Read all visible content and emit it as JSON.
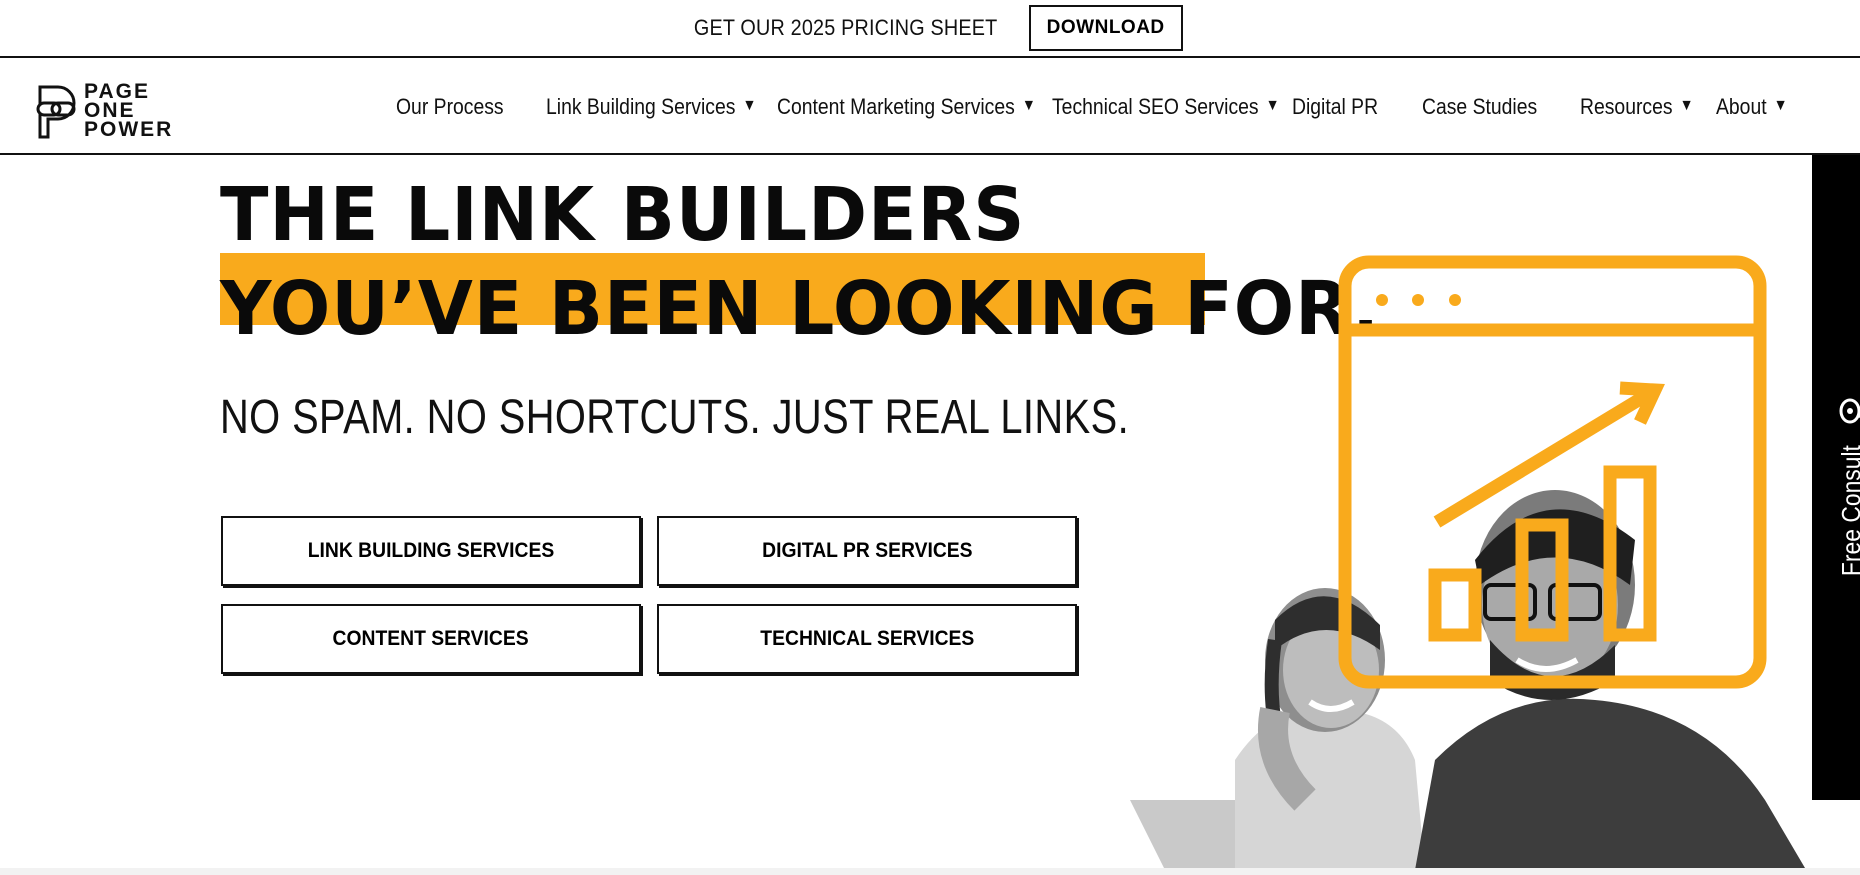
{
  "topbar": {
    "promo_text": "GET OUR 2025 PRICING SHEET",
    "download_label": "DOWNLOAD"
  },
  "brand": {
    "logo_lines": [
      "PAGE",
      "ONE",
      "POWER"
    ],
    "accent_color": "#f9aa1c"
  },
  "nav": {
    "items": [
      {
        "label": "Our Process",
        "has_dropdown": false
      },
      {
        "label": "Link Building Services",
        "has_dropdown": true
      },
      {
        "label": "Content Marketing Services",
        "has_dropdown": true
      },
      {
        "label": "Technical SEO Services",
        "has_dropdown": true
      },
      {
        "label": "Digital PR",
        "has_dropdown": false
      },
      {
        "label": "Case Studies",
        "has_dropdown": false
      },
      {
        "label": "Resources",
        "has_dropdown": true
      },
      {
        "label": "About",
        "has_dropdown": true
      }
    ],
    "caret_icon": "caret-down-icon"
  },
  "hero": {
    "title_line1": "THE LINK BUILDERS",
    "title_line2": "YOU’VE BEEN LOOKING FOR.",
    "subtitle": "NO SPAM. NO SHORTCUTS. JUST REAL LINKS.",
    "buttons": [
      {
        "label": "LINK BUILDING SERVICES"
      },
      {
        "label": "DIGITAL PR SERVICES"
      },
      {
        "label": "CONTENT SERVICES"
      },
      {
        "label": "TECHNICAL SERVICES"
      }
    ]
  },
  "consult_tab": {
    "label": "Free Consult",
    "icon": "chat-bubble-icon"
  }
}
